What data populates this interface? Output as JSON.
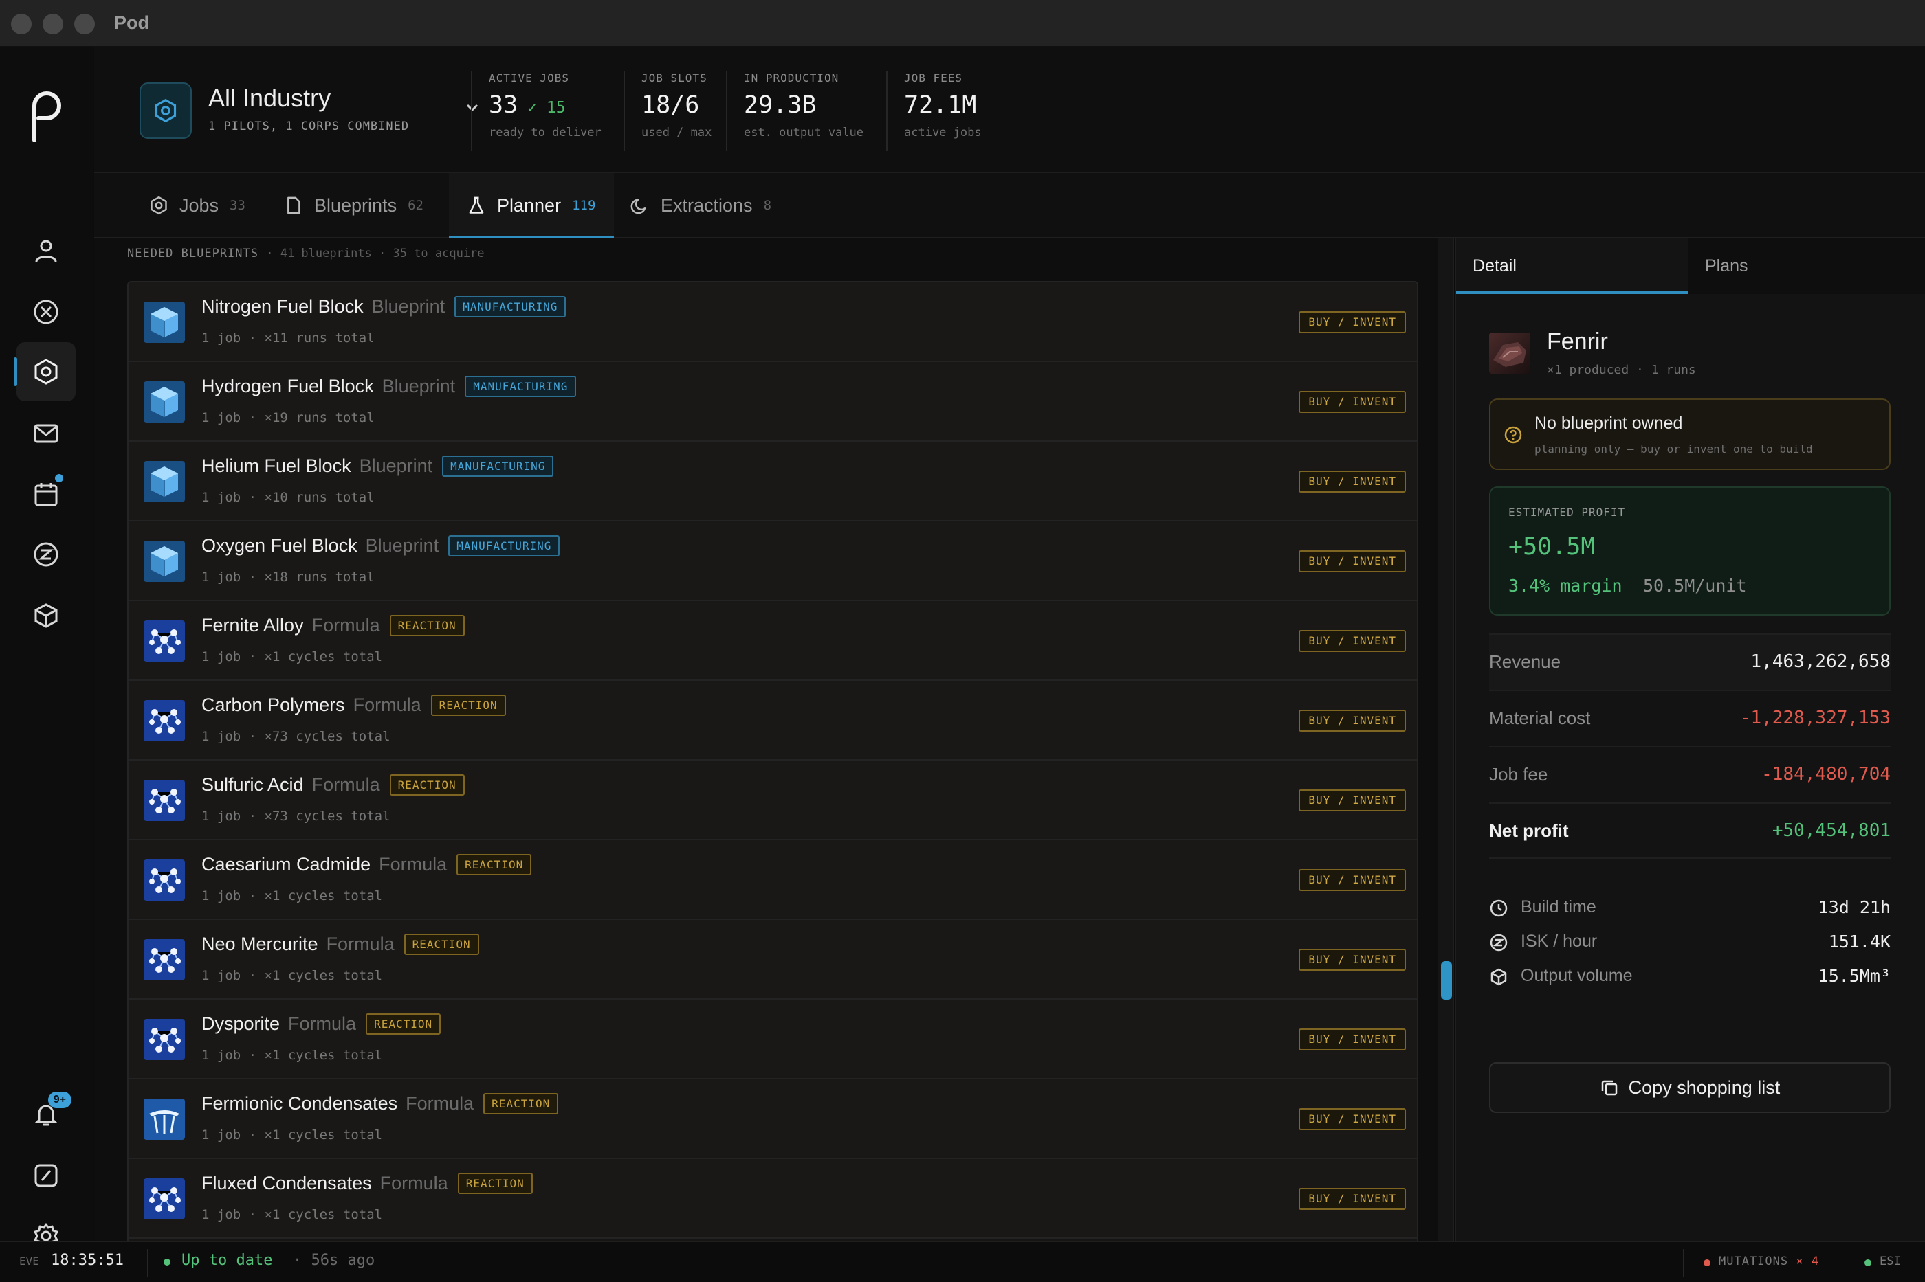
{
  "window": {
    "title": "Pod"
  },
  "header": {
    "scope": {
      "title": "All Industry",
      "subtitle": "1 PILOTS, 1 CORPS COMBINED"
    },
    "stats": [
      {
        "label": "ACTIVE JOBS",
        "value": "33",
        "extra": "✓ 15",
        "sub": "ready to deliver"
      },
      {
        "label": "JOB SLOTS",
        "value": "18/6",
        "sub": "used / max"
      },
      {
        "label": "IN PRODUCTION",
        "value": "29.3B",
        "sub": "est. output value"
      },
      {
        "label": "JOB FEES",
        "value": "72.1M",
        "sub": "active jobs"
      }
    ]
  },
  "tabs": [
    {
      "label": "Jobs",
      "count": "33",
      "icon": "hexagon-icon"
    },
    {
      "label": "Blueprints",
      "count": "62",
      "icon": "document-icon"
    },
    {
      "label": "Planner",
      "count": "119",
      "icon": "flask-icon",
      "active": true
    },
    {
      "label": "Extractions",
      "count": "8",
      "icon": "moon-icon"
    }
  ],
  "list": {
    "heading": "NEEDED BLUEPRINTS",
    "subheading": "· 41 blueprints · 35 to acquire",
    "action_label": "BUY / INVENT",
    "rows": [
      {
        "name": "Nitrogen Fuel Block",
        "kind": "Blueprint",
        "tag": "MANUFACTURING",
        "meta": "1 job · ×11 runs total",
        "icon": "fuel-block-icon"
      },
      {
        "name": "Hydrogen Fuel Block",
        "kind": "Blueprint",
        "tag": "MANUFACTURING",
        "meta": "1 job · ×19 runs total",
        "icon": "fuel-block-icon"
      },
      {
        "name": "Helium Fuel Block",
        "kind": "Blueprint",
        "tag": "MANUFACTURING",
        "meta": "1 job · ×10 runs total",
        "icon": "fuel-block-icon"
      },
      {
        "name": "Oxygen Fuel Block",
        "kind": "Blueprint",
        "tag": "MANUFACTURING",
        "meta": "1 job · ×18 runs total",
        "icon": "fuel-block-icon"
      },
      {
        "name": "Fernite Alloy",
        "kind": "Formula",
        "tag": "REACTION",
        "meta": "1 job · ×1 cycles total",
        "icon": "molecule-icon"
      },
      {
        "name": "Carbon Polymers",
        "kind": "Formula",
        "tag": "REACTION",
        "meta": "1 job · ×73 cycles total",
        "icon": "molecule-icon"
      },
      {
        "name": "Sulfuric Acid",
        "kind": "Formula",
        "tag": "REACTION",
        "meta": "1 job · ×73 cycles total",
        "icon": "molecule-icon"
      },
      {
        "name": "Caesarium Cadmide",
        "kind": "Formula",
        "tag": "REACTION",
        "meta": "1 job · ×1 cycles total",
        "icon": "molecule-icon"
      },
      {
        "name": "Neo Mercurite",
        "kind": "Formula",
        "tag": "REACTION",
        "meta": "1 job · ×1 cycles total",
        "icon": "molecule-icon"
      },
      {
        "name": "Dysporite",
        "kind": "Formula",
        "tag": "REACTION",
        "meta": "1 job · ×1 cycles total",
        "icon": "molecule-icon"
      },
      {
        "name": "Fermionic Condensates",
        "kind": "Formula",
        "tag": "REACTION",
        "meta": "1 job · ×1 cycles total",
        "icon": "condensate-icon"
      },
      {
        "name": "Fluxed Condensates",
        "kind": "Formula",
        "tag": "REACTION",
        "meta": "1 job · ×1 cycles total",
        "icon": "molecule-icon"
      }
    ]
  },
  "detail": {
    "tabs": [
      "Detail",
      "Plans"
    ],
    "product": {
      "name": "Fenrir",
      "sub": "×1 produced · 1 runs"
    },
    "warning": {
      "title": "No blueprint owned",
      "sub": "planning only — buy or invent one to build"
    },
    "profit": {
      "label": "ESTIMATED PROFIT",
      "value": "+50.5M",
      "margin": "3.4% margin",
      "per_unit": "50.5M/unit"
    },
    "breakdown": [
      {
        "label": "Revenue",
        "value": "1,463,262,658",
        "tone": "neutral"
      },
      {
        "label": "Material cost",
        "value": "-1,228,327,153",
        "tone": "neg"
      },
      {
        "label": "Job fee",
        "value": "-184,480,704",
        "tone": "neg"
      },
      {
        "label": "Net profit",
        "value": "+50,454,801",
        "tone": "pos"
      }
    ],
    "metrics": [
      {
        "label": "Build time",
        "value": "13d 21h",
        "icon": "clock-icon"
      },
      {
        "label": "ISK / hour",
        "value": "151.4K",
        "icon": "isk-icon"
      },
      {
        "label": "Output volume",
        "value": "15.5Mm³",
        "icon": "cube-icon"
      }
    ],
    "copy_label": "Copy shopping list"
  },
  "status": {
    "eve_label": "EVE",
    "time": "18:35:51",
    "sync": "Up to date",
    "ago": "· 56s ago",
    "mutations_label": "MUTATIONS",
    "mutations_count": "× 4",
    "esi_label": "ESI"
  },
  "rail": {
    "notification_badge": "9+"
  },
  "colors": {
    "accent": "#2f8fc0",
    "positive": "#54c27a",
    "negative": "#e05a4e",
    "reaction": "#c9a33d",
    "manufacturing": "#46a6d8"
  }
}
